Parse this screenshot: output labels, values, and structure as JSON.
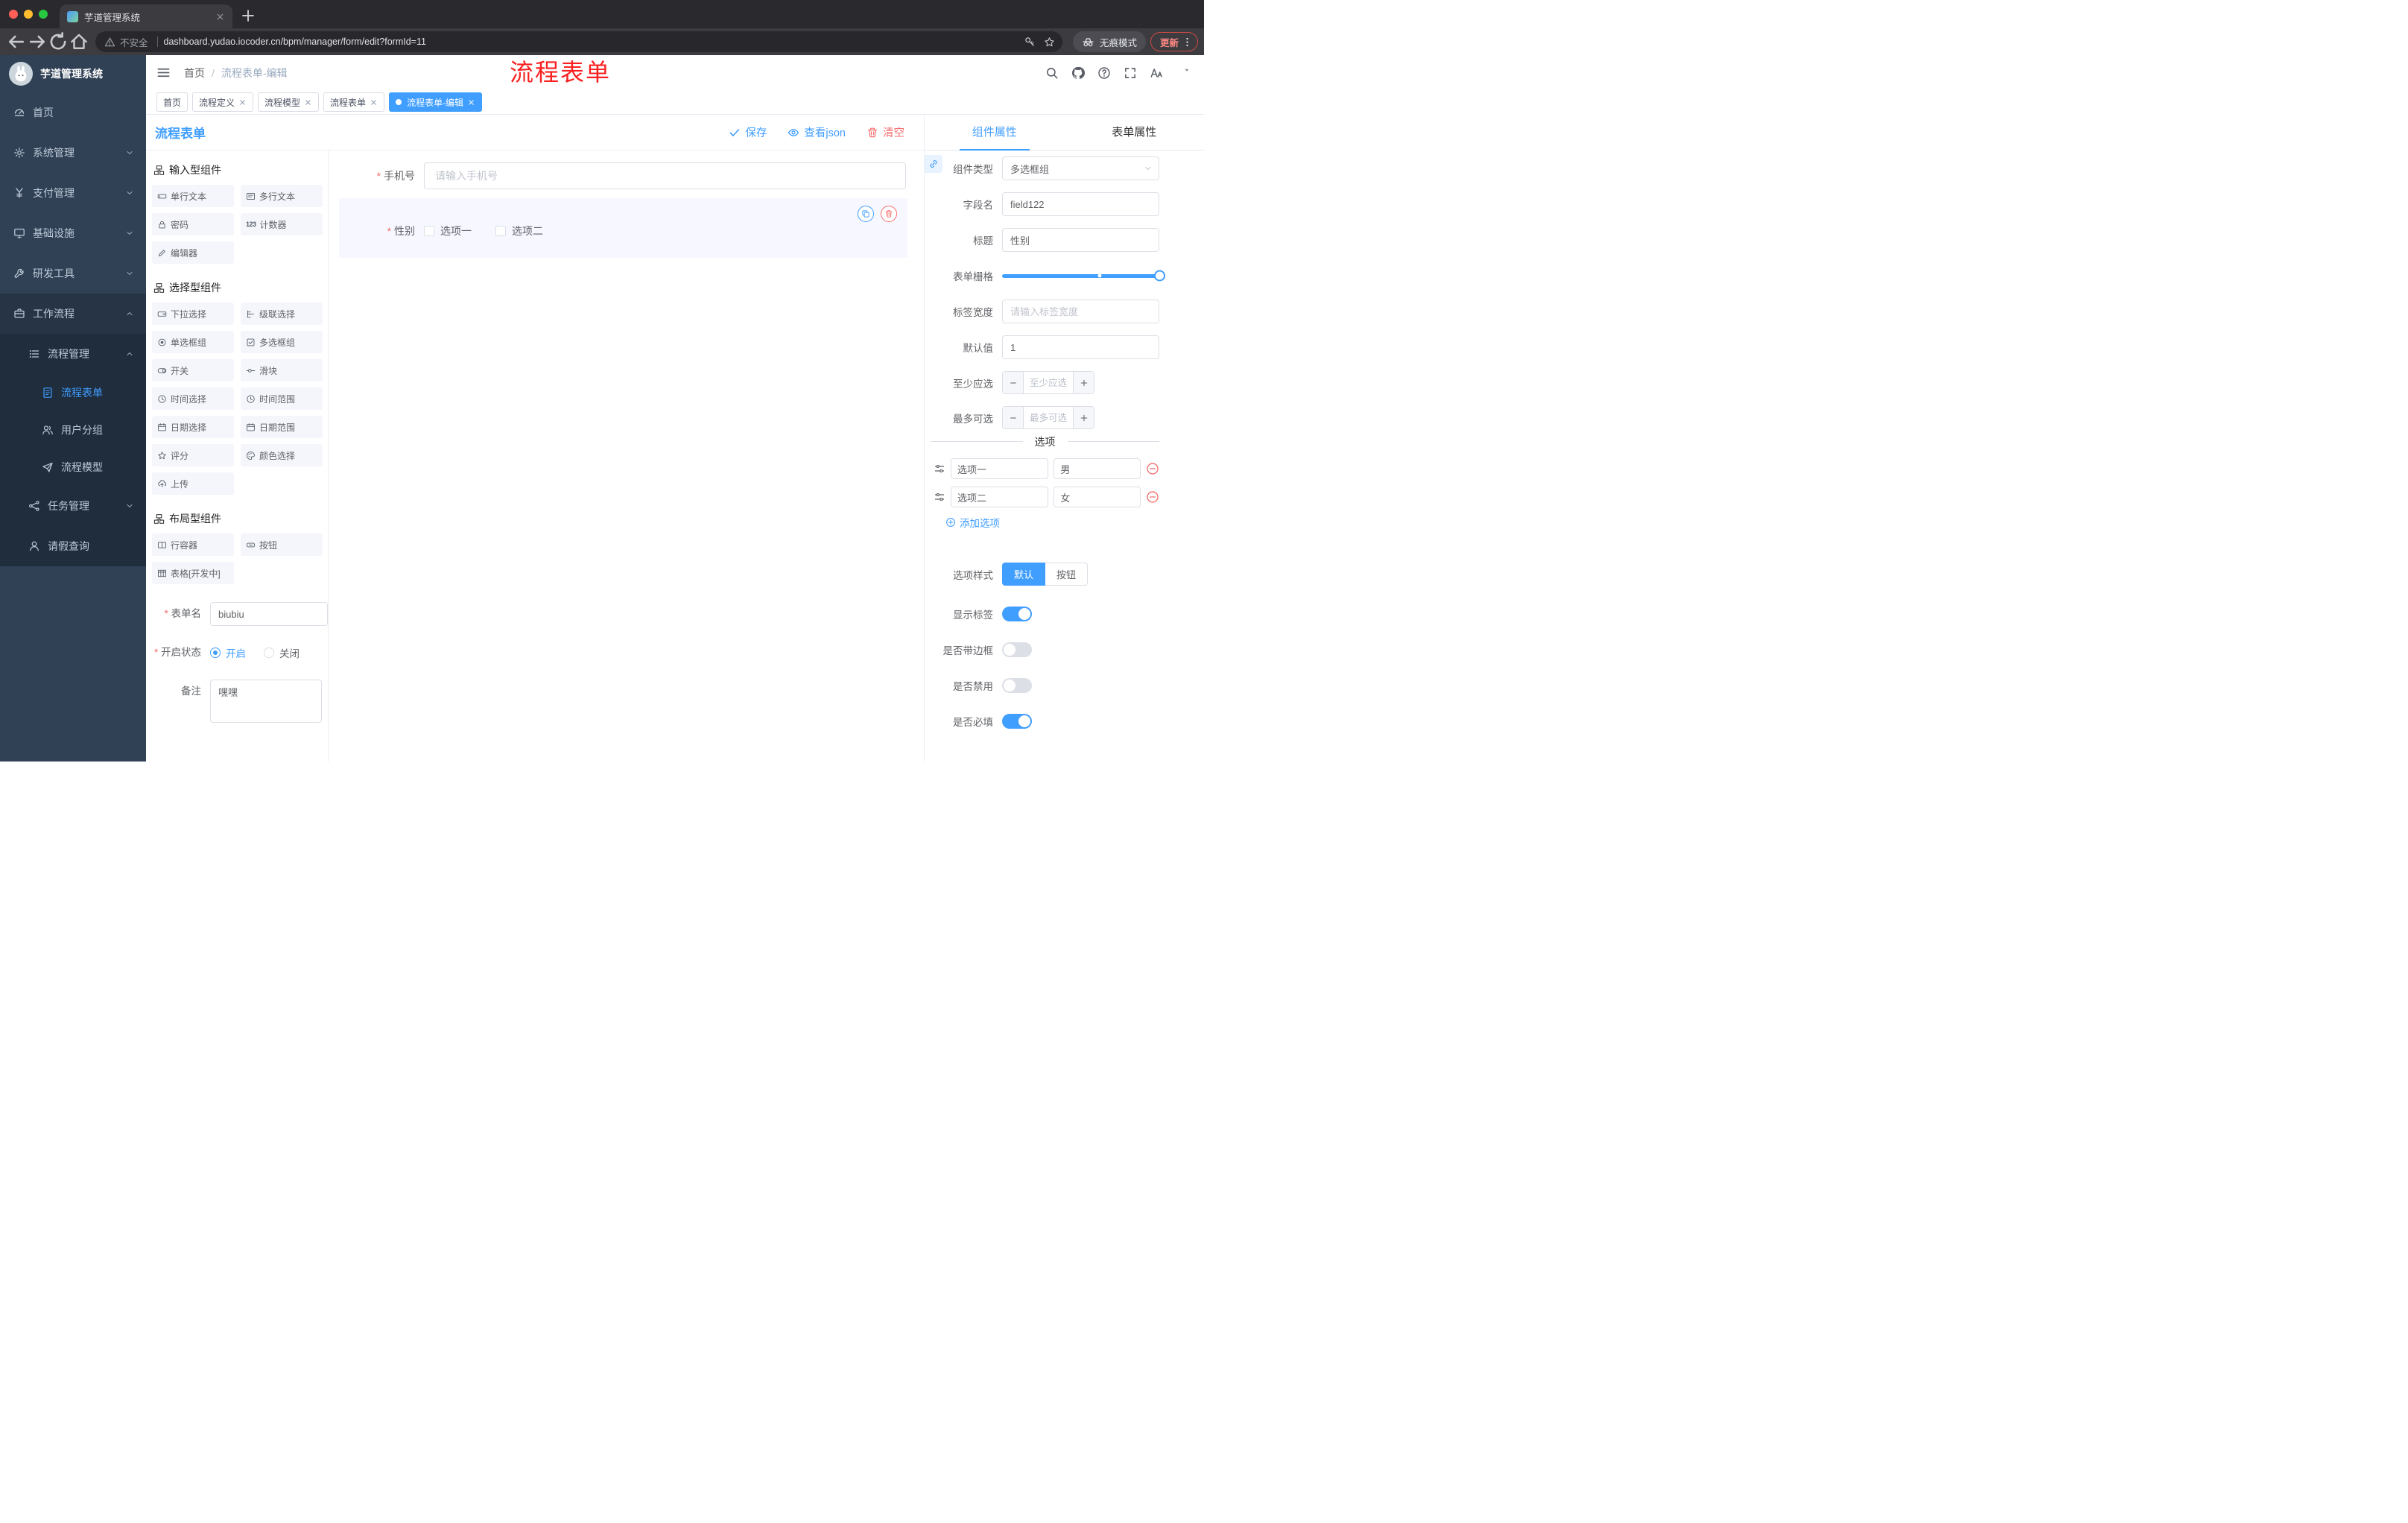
{
  "browser": {
    "tab_title": "芋道管理系统",
    "security_label": "不安全",
    "url": "dashboard.yudao.iocoder.cn/bpm/manager/form/edit?formId=11",
    "incognito_label": "无痕模式",
    "update_label": "更新"
  },
  "sidebar": {
    "logo_title": "芋道管理系统",
    "items": [
      {
        "label": "首页"
      },
      {
        "label": "系统管理"
      },
      {
        "label": "支付管理"
      },
      {
        "label": "基础设施"
      },
      {
        "label": "研发工具"
      },
      {
        "label": "工作流程"
      },
      {
        "label": "流程管理"
      },
      {
        "label": "流程表单"
      },
      {
        "label": "用户分组"
      },
      {
        "label": "流程模型"
      },
      {
        "label": "任务管理"
      },
      {
        "label": "请假查询"
      }
    ]
  },
  "navbar": {
    "breadcrumb": {
      "home": "首页",
      "separator": "/",
      "current": "流程表单-编辑"
    },
    "annotation": "流程表单"
  },
  "tags": [
    {
      "label": "首页"
    },
    {
      "label": "流程定义"
    },
    {
      "label": "流程模型"
    },
    {
      "label": "流程表单"
    },
    {
      "label": "流程表单-编辑"
    }
  ],
  "editor": {
    "title": "流程表单",
    "actions": {
      "save": "保存",
      "view_json": "查看json",
      "clear": "清空"
    },
    "counter_icon_text": "123",
    "groups": [
      {
        "title": "输入型组件",
        "items": [
          {
            "label": "单行文本"
          },
          {
            "label": "多行文本"
          },
          {
            "label": "密码"
          },
          {
            "label": "计数器"
          },
          {
            "label": "编辑器"
          }
        ]
      },
      {
        "title": "选择型组件",
        "items": [
          {
            "label": "下拉选择"
          },
          {
            "label": "级联选择"
          },
          {
            "label": "单选框组"
          },
          {
            "label": "多选框组"
          },
          {
            "label": "开关"
          },
          {
            "label": "滑块"
          },
          {
            "label": "时间选择"
          },
          {
            "label": "时间范围"
          },
          {
            "label": "日期选择"
          },
          {
            "label": "日期范围"
          },
          {
            "label": "评分"
          },
          {
            "label": "颜色选择"
          },
          {
            "label": "上传"
          }
        ]
      },
      {
        "title": "布局型组件",
        "items": [
          {
            "label": "行容器"
          },
          {
            "label": "按钮"
          },
          {
            "label": "表格[开发中]"
          }
        ]
      }
    ],
    "meta": {
      "name_label": "表单名",
      "name_value": "biubiu",
      "status_label": "开启状态",
      "status_on": "开启",
      "status_off": "关闭",
      "status_selected": "开启",
      "remark_label": "备注",
      "remark_value": "嘿嘿"
    }
  },
  "canvas": {
    "phone": {
      "label": "手机号",
      "placeholder": "请输入手机号",
      "required": true
    },
    "gender": {
      "label": "性别",
      "option1": "选项一",
      "option2": "选项二",
      "required": true,
      "selected": true
    }
  },
  "props": {
    "tab_component": "组件属性",
    "tab_form": "表单属性",
    "active_tab": "组件属性",
    "rows": {
      "type_label": "组件类型",
      "type_value": "多选框组",
      "field_label": "字段名",
      "field_value": "field122",
      "title_label": "标题",
      "title_value": "性别",
      "grid_label": "表单栅格",
      "labelwidth_label": "标签宽度",
      "labelwidth_placeholder": "请输入标签宽度",
      "default_label": "默认值",
      "default_value": "1",
      "min_label": "至少应选",
      "min_placeholder": "至少应选",
      "max_label": "最多可选",
      "max_placeholder": "最多可选"
    },
    "options": {
      "divider": "选项",
      "rows": [
        {
          "label": "选项一",
          "value": "男"
        },
        {
          "label": "选项二",
          "value": "女"
        }
      ],
      "add_label": "添加选项"
    },
    "style": {
      "label": "选项样式",
      "seg_default": "默认",
      "seg_button": "按钮",
      "seg_selected": "默认",
      "switches": [
        {
          "label": "显示标签",
          "on": true
        },
        {
          "label": "是否带边框",
          "on": false
        },
        {
          "label": "是否禁用",
          "on": false
        },
        {
          "label": "是否必填",
          "on": true
        }
      ]
    }
  },
  "colors": {
    "primary": "#409EFF",
    "danger": "#F56C6C",
    "sidebar_bg": "#304156",
    "sidebar_sub_bg": "#1F2D3D",
    "annotation_red": "#FB2020",
    "active_tag_bg": "#409EFF"
  }
}
